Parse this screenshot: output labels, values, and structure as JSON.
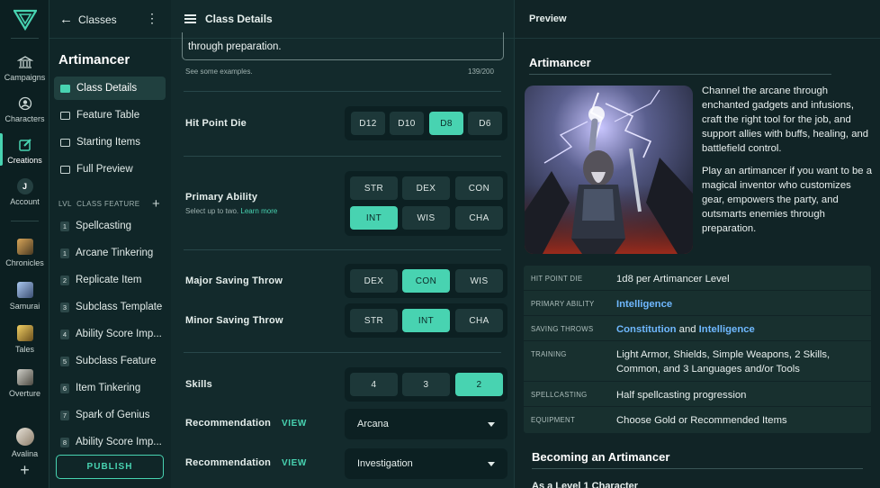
{
  "rail": {
    "items": [
      {
        "label": "Campaigns",
        "icon": "bank-icon"
      },
      {
        "label": "Characters",
        "icon": "person-icon"
      },
      {
        "label": "Creations",
        "icon": "edit-icon"
      },
      {
        "label": "Account",
        "icon": "account-icon",
        "avatar_letter": "J"
      }
    ],
    "chronicles": [
      {
        "label": "Chronicles"
      },
      {
        "label": "Samurai"
      },
      {
        "label": "Tales"
      },
      {
        "label": "Overture"
      },
      {
        "label": "Avalina"
      }
    ]
  },
  "sidebar": {
    "back_label": "Classes",
    "class_name": "Artimancer",
    "nav": [
      {
        "label": "Class Details"
      },
      {
        "label": "Feature Table"
      },
      {
        "label": "Starting Items"
      },
      {
        "label": "Full Preview"
      }
    ],
    "feature_header": {
      "lvl": "LVL",
      "label": "CLASS FEATURE"
    },
    "features": [
      {
        "lvl": "1",
        "name": "Spellcasting"
      },
      {
        "lvl": "1",
        "name": "Arcane Tinkering"
      },
      {
        "lvl": "2",
        "name": "Replicate Item"
      },
      {
        "lvl": "3",
        "name": "Subclass Template"
      },
      {
        "lvl": "4",
        "name": "Ability Score Imp..."
      },
      {
        "lvl": "5",
        "name": "Subclass Feature"
      },
      {
        "lvl": "6",
        "name": "Item Tinkering"
      },
      {
        "lvl": "7",
        "name": "Spark of Genius"
      },
      {
        "lvl": "8",
        "name": "Ability Score Imp..."
      }
    ],
    "publish_label": "PUBLISH"
  },
  "main": {
    "title": "Class Details",
    "description_tail": "through preparation.",
    "hint": "See some examples.",
    "count": "139/200",
    "hit_point_die": {
      "label": "Hit Point Die",
      "options": [
        "D12",
        "D10",
        "D8",
        "D6"
      ],
      "selected": "D8"
    },
    "primary_ability": {
      "label": "Primary Ability",
      "sub": "Select up to two.",
      "learn_more": "Learn more",
      "options": [
        "STR",
        "DEX",
        "CON",
        "INT",
        "WIS",
        "CHA"
      ],
      "selected": [
        "INT"
      ]
    },
    "major_saving_throw": {
      "label": "Major Saving Throw",
      "options": [
        "DEX",
        "CON",
        "WIS"
      ],
      "selected": "CON"
    },
    "minor_saving_throw": {
      "label": "Minor Saving Throw",
      "options": [
        "STR",
        "INT",
        "CHA"
      ],
      "selected": "INT"
    },
    "skills": {
      "label": "Skills",
      "options": [
        "4",
        "3",
        "2"
      ],
      "selected": "2"
    },
    "recommendations": [
      {
        "label": "Recommendation",
        "view": "VIEW",
        "value": "Arcana"
      },
      {
        "label": "Recommendation",
        "view": "VIEW",
        "value": "Investigation"
      }
    ]
  },
  "preview": {
    "header": "Preview",
    "title": "Artimancer",
    "desc1": "Channel the arcane through enchanted gadgets and infusions, craft the right tool for the job, and support allies with buffs, healing, and battlefield control.",
    "desc2": "Play an artimancer if you want to be a magical inventor who customizes gear, empowers the party, and outsmarts enemies through preparation.",
    "table": [
      {
        "key": "HIT POINT DIE",
        "value": "1d8 per Artimancer Level"
      },
      {
        "key": "PRIMARY ABILITY",
        "value": "Intelligence"
      },
      {
        "key": "SAVING THROWS",
        "v1": "Constitution",
        "and": "and",
        "v2": "Intelligence"
      },
      {
        "key": "TRAINING",
        "value": "Light Armor, Shields, Simple Weapons, 2 Skills, Common, and 3 Languages and/or Tools"
      },
      {
        "key": "SPELLCASTING",
        "value": "Half spellcasting progression"
      },
      {
        "key": "EQUIPMENT",
        "value": "Choose Gold or Recommended Items"
      }
    ],
    "becoming": "Becoming an Artimancer",
    "level1": "As a Level 1 Character"
  },
  "colors": {
    "accent": "#48d3b1",
    "link": "#6fb8ff",
    "bg": "#132a2c"
  }
}
